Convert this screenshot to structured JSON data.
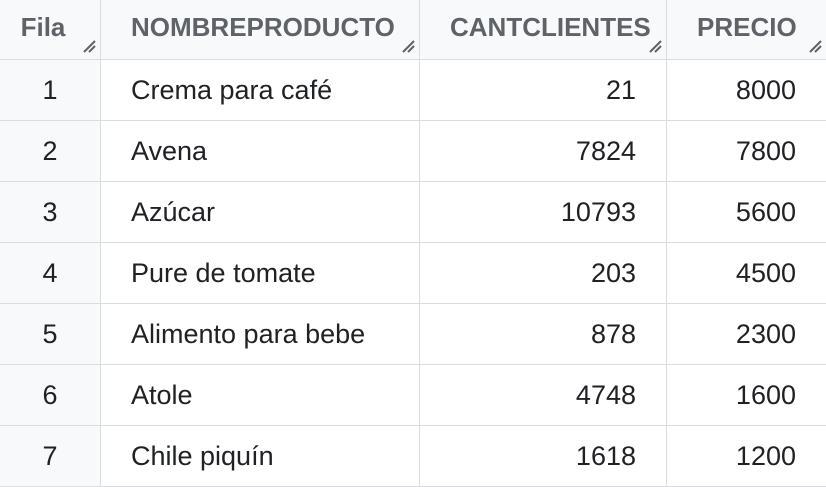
{
  "table": {
    "headers": [
      "Fila",
      "NOMBREPRODUCTO",
      "CANTCLIENTES",
      "PRECIO"
    ],
    "rows": [
      {
        "fila": "1",
        "nombre": "Crema para café",
        "cant": "21",
        "precio": "8000"
      },
      {
        "fila": "2",
        "nombre": "Avena",
        "cant": "7824",
        "precio": "7800"
      },
      {
        "fila": "3",
        "nombre": "Azúcar",
        "cant": "10793",
        "precio": "5600"
      },
      {
        "fila": "4",
        "nombre": "Pure de tomate",
        "cant": "203",
        "precio": "4500"
      },
      {
        "fila": "5",
        "nombre": "Alimento para bebe",
        "cant": "878",
        "precio": "2300"
      },
      {
        "fila": "6",
        "nombre": "Atole",
        "cant": "4748",
        "precio": "1600"
      },
      {
        "fila": "7",
        "nombre": "Chile piquín",
        "cant": "1618",
        "precio": "1200"
      }
    ]
  },
  "icons": {
    "column_resize": "resize-handle-icon"
  },
  "colors": {
    "header_bg": "#f8f9fa",
    "grid_line": "#dadce0",
    "header_text": "#5f6368",
    "cell_text": "#202124"
  }
}
